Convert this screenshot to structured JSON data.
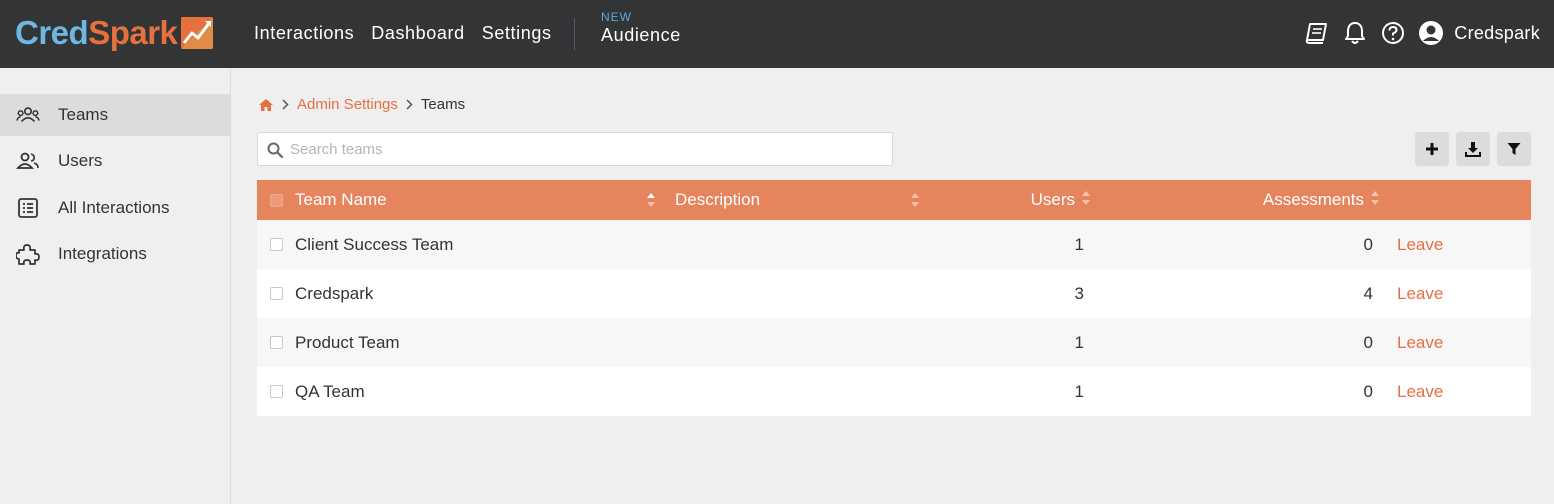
{
  "brand": {
    "name_part1": "Cred",
    "name_part2": "Spark",
    "logo_icon": "spark-chart-icon"
  },
  "topnav": {
    "items": [
      {
        "label": "Interactions"
      },
      {
        "label": "Dashboard"
      },
      {
        "label": "Settings"
      }
    ],
    "audience": {
      "badge": "NEW",
      "label": "Audience"
    }
  },
  "user_menu": {
    "icons": [
      "book-icon",
      "bell-icon",
      "help-icon",
      "user-avatar-icon"
    ],
    "username": "Credspark"
  },
  "sidebar": {
    "items": [
      {
        "label": "Teams",
        "icon": "teams-icon",
        "active": true
      },
      {
        "label": "Users",
        "icon": "users-icon",
        "active": false
      },
      {
        "label": "All Interactions",
        "icon": "list-icon",
        "active": false
      },
      {
        "label": "Integrations",
        "icon": "puzzle-icon",
        "active": false
      }
    ]
  },
  "breadcrumb": {
    "home_icon": "home-icon",
    "link": "Admin Settings",
    "current": "Teams"
  },
  "search": {
    "placeholder": "Search teams",
    "value": ""
  },
  "actions": {
    "icons": [
      "plus-icon",
      "download-icon",
      "filter-icon"
    ]
  },
  "table": {
    "columns": {
      "team_name": "Team Name",
      "description": "Description",
      "users": "Users",
      "assessments": "Assessments"
    },
    "rows": [
      {
        "team_name": "Client Success Team",
        "description": "",
        "users": "1",
        "assessments": "0",
        "action": "Leave"
      },
      {
        "team_name": "Credspark",
        "description": "",
        "users": "3",
        "assessments": "4",
        "action": "Leave"
      },
      {
        "team_name": "Product Team",
        "description": "",
        "users": "1",
        "assessments": "0",
        "action": "Leave"
      },
      {
        "team_name": "QA Team",
        "description": "",
        "users": "1",
        "assessments": "0",
        "action": "Leave"
      }
    ]
  },
  "colors": {
    "accent": "#e6713f",
    "table_header": "#e6845e",
    "topbar": "#333436",
    "brand_blue": "#6fb7e3"
  }
}
